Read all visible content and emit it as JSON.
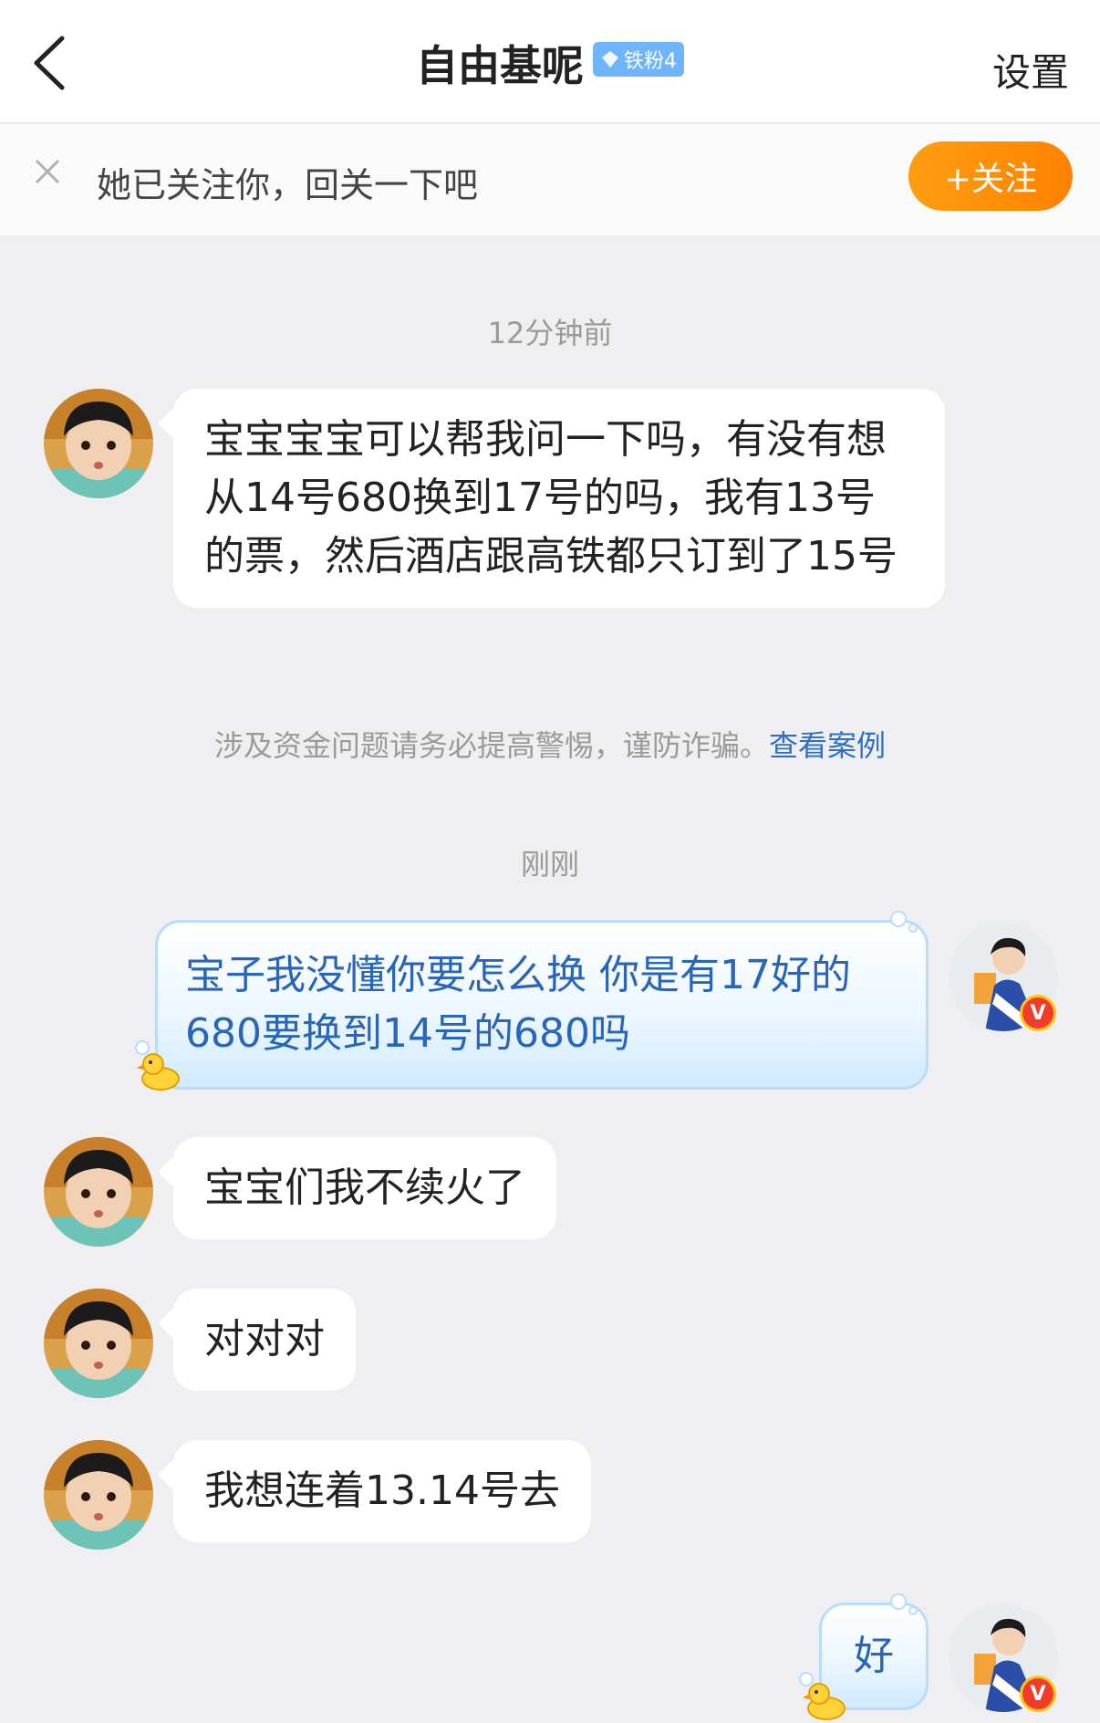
{
  "header": {
    "title": "自由基呢",
    "fan_badge": "铁粉4",
    "settings_label": "设置"
  },
  "follow_bar": {
    "text": "她已关注你，回关一下吧",
    "button_label": "+关注"
  },
  "chat": {
    "time1": "12分钟前",
    "msg1": "宝宝宝宝可以帮我问一下吗，有没有想从14号680换到17号的吗，我有13号的票，然后酒店跟高铁都只订到了15号",
    "notice_text": "涉及资金问题请务必提高警惕，谨防诈骗。",
    "notice_link": "查看案例",
    "time2": "刚刚",
    "msg2": "宝子我没懂你要怎么换 你是有17好的680要换到14号的680吗",
    "msg3": "宝宝们我不续火了",
    "msg4": "对对对",
    "msg5": "我想连着13.14号去",
    "msg6": "好"
  },
  "colors": {
    "accent_orange": "#ff8a00",
    "link_blue": "#2e6fc4",
    "own_bubble_text": "#2a66b8",
    "background": "#efeff1"
  }
}
